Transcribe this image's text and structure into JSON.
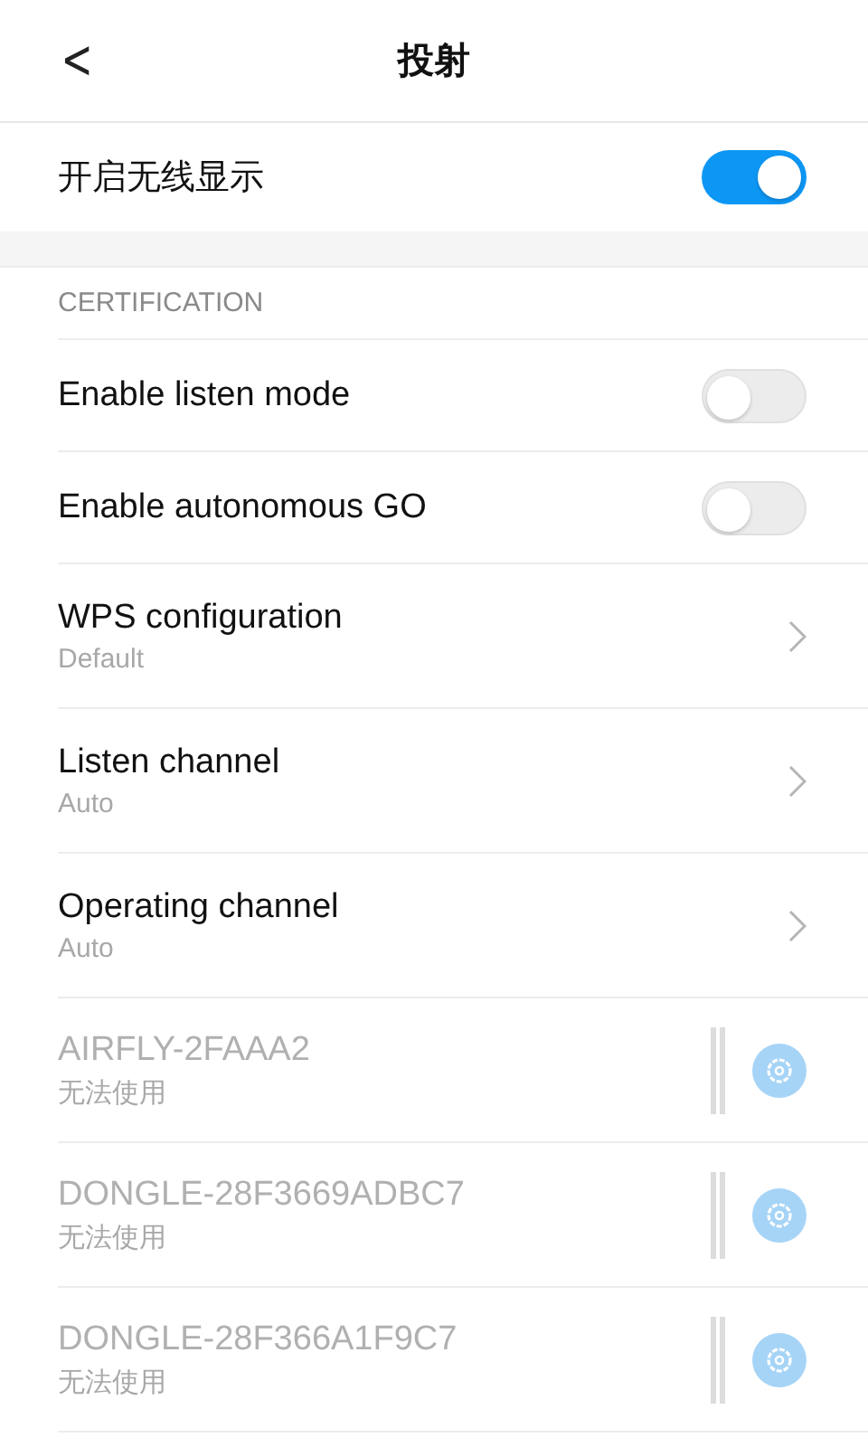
{
  "header": {
    "back": "<",
    "title": "投射"
  },
  "main_switch": {
    "label": "开启无线显示",
    "on": true
  },
  "section": {
    "title": "CERTIFICATION"
  },
  "items": [
    {
      "kind": "toggle",
      "label": "Enable listen mode",
      "on": false
    },
    {
      "kind": "toggle",
      "label": "Enable autonomous GO",
      "on": false
    },
    {
      "kind": "nav",
      "label": "WPS configuration",
      "value": "Default"
    },
    {
      "kind": "nav",
      "label": "Listen channel",
      "value": "Auto"
    },
    {
      "kind": "nav",
      "label": "Operating channel",
      "value": "Auto"
    },
    {
      "kind": "device",
      "label": "AIRFLY-2FAAA2",
      "value": "无法使用",
      "disabled": true
    },
    {
      "kind": "device",
      "label": "DONGLE-28F3669ADBC7",
      "value": "无法使用",
      "disabled": true
    },
    {
      "kind": "device",
      "label": "DONGLE-28F366A1F9C7",
      "value": "无法使用",
      "disabled": true
    }
  ]
}
